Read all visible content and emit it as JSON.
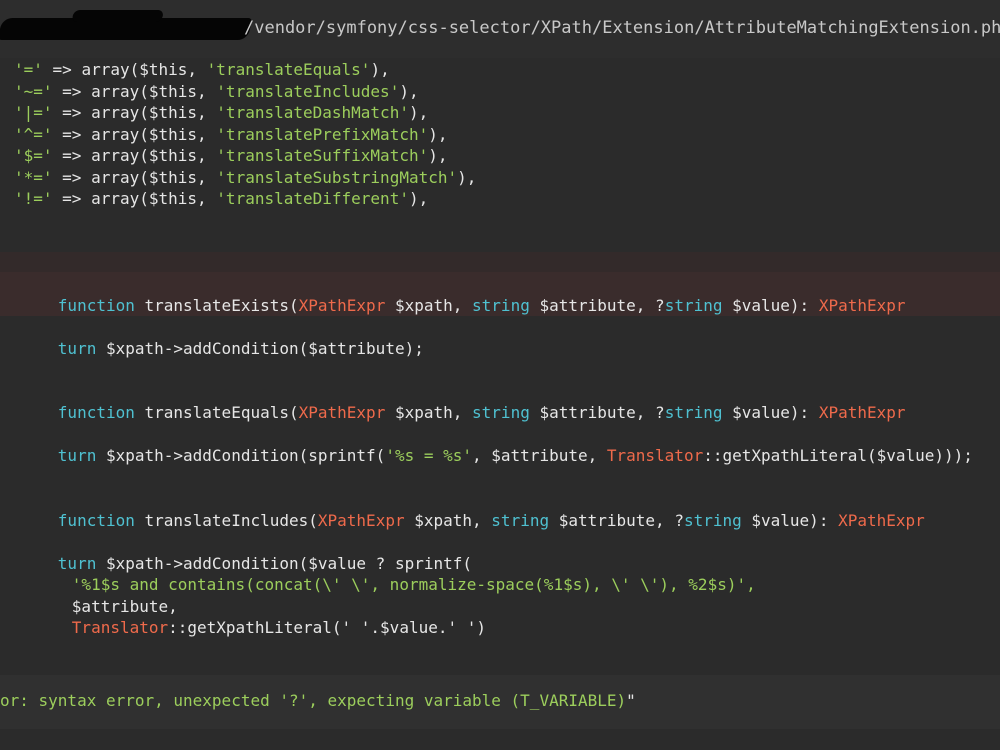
{
  "header": {
    "path": "/vendor/symfony/css-selector/XPath/Extension/AttributeMatchingExtension.php"
  },
  "code": {
    "array_lines": [
      {
        "key": "'='",
        "fn": "'translateEquals'"
      },
      {
        "key": "'~='",
        "fn": "'translateIncludes'"
      },
      {
        "key": "'|='",
        "fn": "'translateDashMatch'"
      },
      {
        "key": "'^='",
        "fn": "'translatePrefixMatch'"
      },
      {
        "key": "'$='",
        "fn": "'translateSuffixMatch'"
      },
      {
        "key": "'*='",
        "fn": "'translateSubstringMatch'"
      },
      {
        "key": "'!='",
        "fn": "'translateDifferent'"
      }
    ],
    "arrow": " => ",
    "array_open": "array($this, ",
    "array_close": "),",
    "fn_exists": {
      "keyword": "function",
      "name": " translateExists(",
      "type1": "XPathExpr",
      "arg1": " $xpath, ",
      "type2": "string",
      "arg2": " $attribute, ?",
      "type3": "string",
      "arg3": " $value): ",
      "ret": "XPathExpr"
    },
    "ret_exists": {
      "keyword": "turn",
      "rest": " $xpath->addCondition($attribute);"
    },
    "fn_equals": {
      "keyword": "function",
      "name": " translateEquals(",
      "type1": "XPathExpr",
      "arg1": " $xpath, ",
      "type2": "string",
      "arg2": " $attribute, ?",
      "type3": "string",
      "arg3": " $value): ",
      "ret": "XPathExpr"
    },
    "ret_equals": {
      "keyword": "turn",
      "pre": " $xpath->addCondition(sprintf(",
      "str": "'%s = %s'",
      "mid": ", $attribute, ",
      "cls": "Translator",
      "post": "::getXpathLiteral($value)));"
    },
    "fn_includes": {
      "keyword": "function",
      "name": " translateIncludes(",
      "type1": "XPathExpr",
      "arg1": " $xpath, ",
      "type2": "string",
      "arg2": " $attribute, ?",
      "type3": "string",
      "arg3": " $value): ",
      "ret": "XPathExpr"
    },
    "ret_includes": {
      "keyword": "turn",
      "rest": " $xpath->addCondition($value ? sprintf("
    },
    "sprintf_str": "'%1$s and contains(concat(\\' \\', normalize-space(%1$s), \\' \\'), %2$s)',",
    "sprintf_attr": "$attribute,",
    "sprintf_cls": "Translator",
    "sprintf_tail": "::getXpathLiteral(' '.$value.' ')"
  },
  "error": {
    "prefix": "or: syntax error, unexpected '?', expecting variable (T_VARIABLE)",
    "quote": "\""
  },
  "colors": {
    "background": "#2b2b2b",
    "keyword": "#4fc1d1",
    "string": "#9cce5c",
    "class": "#ef6a4b",
    "highlight": "#3a2c2c"
  }
}
